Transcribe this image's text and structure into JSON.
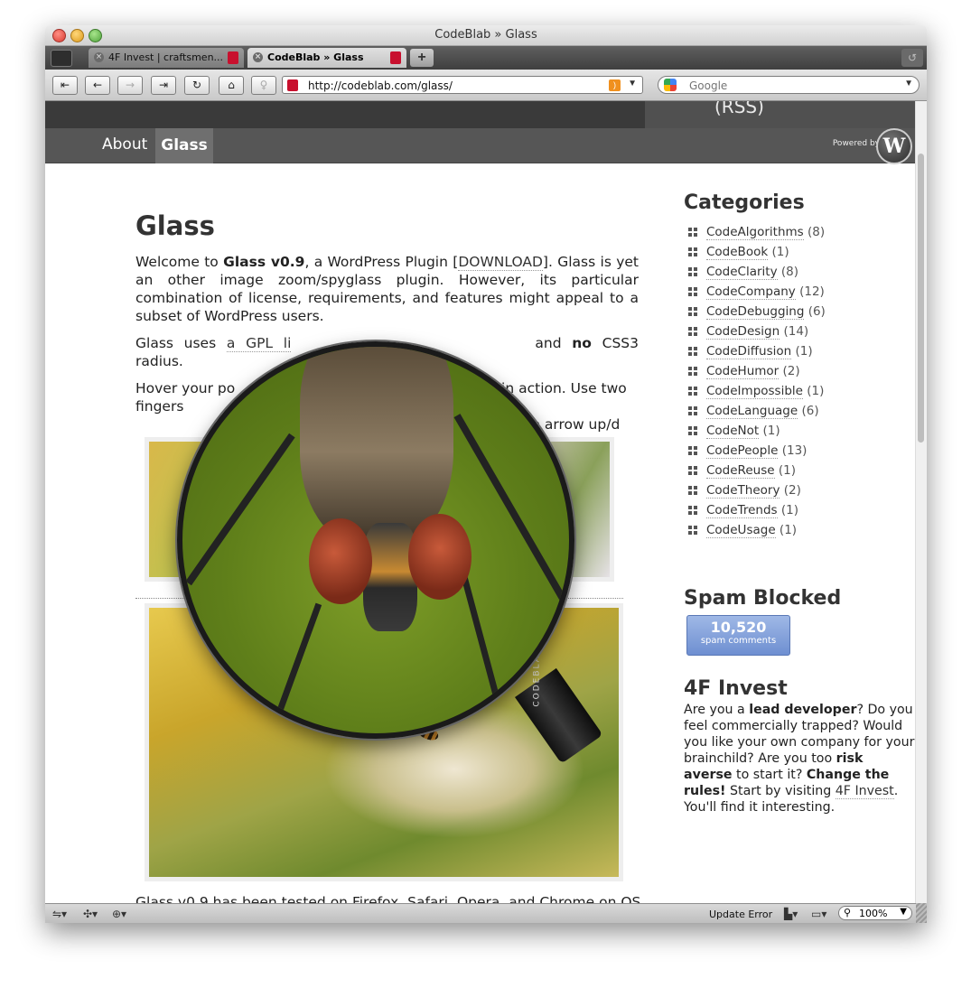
{
  "window": {
    "title": "CodeBlab » Glass"
  },
  "tabs": [
    {
      "label": "4F Invest | craftsmen..."
    },
    {
      "label": "CodeBlab » Glass"
    }
  ],
  "toolbar": {
    "url": "http://codeblab.com/glass/",
    "search_placeholder": "Google",
    "first_icon": "first-page-icon",
    "back_icon": "back-arrow-icon",
    "forward_icon": "forward-arrow-icon",
    "last_icon": "last-page-icon",
    "reload_icon": "reload-icon",
    "home_icon": "home-icon",
    "bookmark_icon": "bookmark-icon"
  },
  "site": {
    "header_rss": "(RSS)",
    "nav": {
      "about": "About",
      "glass": "Glass"
    },
    "powered_by": "Powered by",
    "wp_logo": "W"
  },
  "post": {
    "title": "Glass",
    "p1": {
      "t1": "Welcome to ",
      "b1": "Glass v0.9",
      "t2": ", a WordPress Plugin [",
      "link1": "DOWNLOAD",
      "t3": "]. Glass is yet an other image zoom/spyglass plugin. However, its particular combination of license, requirements, and features might appeal to a subset of WordPress users."
    },
    "p2": {
      "t1": "Glass uses ",
      "link1": "a GPL li",
      "t2": "and ",
      "b1": "no",
      "t3": " CSS3 radius."
    },
    "p3": {
      "t1": "Hover your po",
      "t2": "9 in action. Use two fingers",
      "t3": "our mouse, the arrow up/d"
    },
    "lens_brand": "CODEBLAB",
    "cut": {
      "t1": "Glass v0.9 has been tested on ",
      "l1": "Firefox",
      "t2": ", ",
      "l2": "Safari",
      "t3": ", ",
      "l3": "Opera",
      "t4": ", and ",
      "l4": "Chrome",
      "t5": " on ",
      "l5": "OS X"
    }
  },
  "sidebar": {
    "categories_title": "Categories",
    "categories": [
      {
        "name": "CodeAlgorithms",
        "count": "(8)"
      },
      {
        "name": "CodeBook",
        "count": "(1)"
      },
      {
        "name": "CodeClarity",
        "count": "(8)"
      },
      {
        "name": "CodeCompany",
        "count": "(12)"
      },
      {
        "name": "CodeDebugging",
        "count": "(6)"
      },
      {
        "name": "CodeDesign",
        "count": "(14)"
      },
      {
        "name": "CodeDiffusion",
        "count": "(1)"
      },
      {
        "name": "CodeHumor",
        "count": "(2)"
      },
      {
        "name": "CodeImpossible",
        "count": "(1)"
      },
      {
        "name": "CodeLanguage",
        "count": "(6)"
      },
      {
        "name": "CodeNot",
        "count": "(1)"
      },
      {
        "name": "CodePeople",
        "count": "(13)"
      },
      {
        "name": "CodeReuse",
        "count": "(1)"
      },
      {
        "name": "CodeTheory",
        "count": "(2)"
      },
      {
        "name": "CodeTrends",
        "count": "(1)"
      },
      {
        "name": "CodeUsage",
        "count": "(1)"
      }
    ],
    "spam_title": "Spam Blocked",
    "spam_count": "10,520",
    "spam_label": "spam comments",
    "invest_title": "4F Invest",
    "invest": {
      "t1": "Are you a ",
      "b1": "lead developer",
      "t2": "? Do you feel commercially trapped? Would you like your own company for your brainchild? Are you too ",
      "b2": "risk averse",
      "t3": " to start it? ",
      "b3": "Change the rules!",
      "t4": " Start by visiting ",
      "link": "4F Invest",
      "t5": ". You'll find it interesting."
    }
  },
  "statusbar": {
    "status": "Update Error",
    "zoom": "100%"
  },
  "colors": {
    "spam_badge": "#7a98d6",
    "nav_bg": "#565656",
    "header_bg": "#3a3a3a"
  }
}
